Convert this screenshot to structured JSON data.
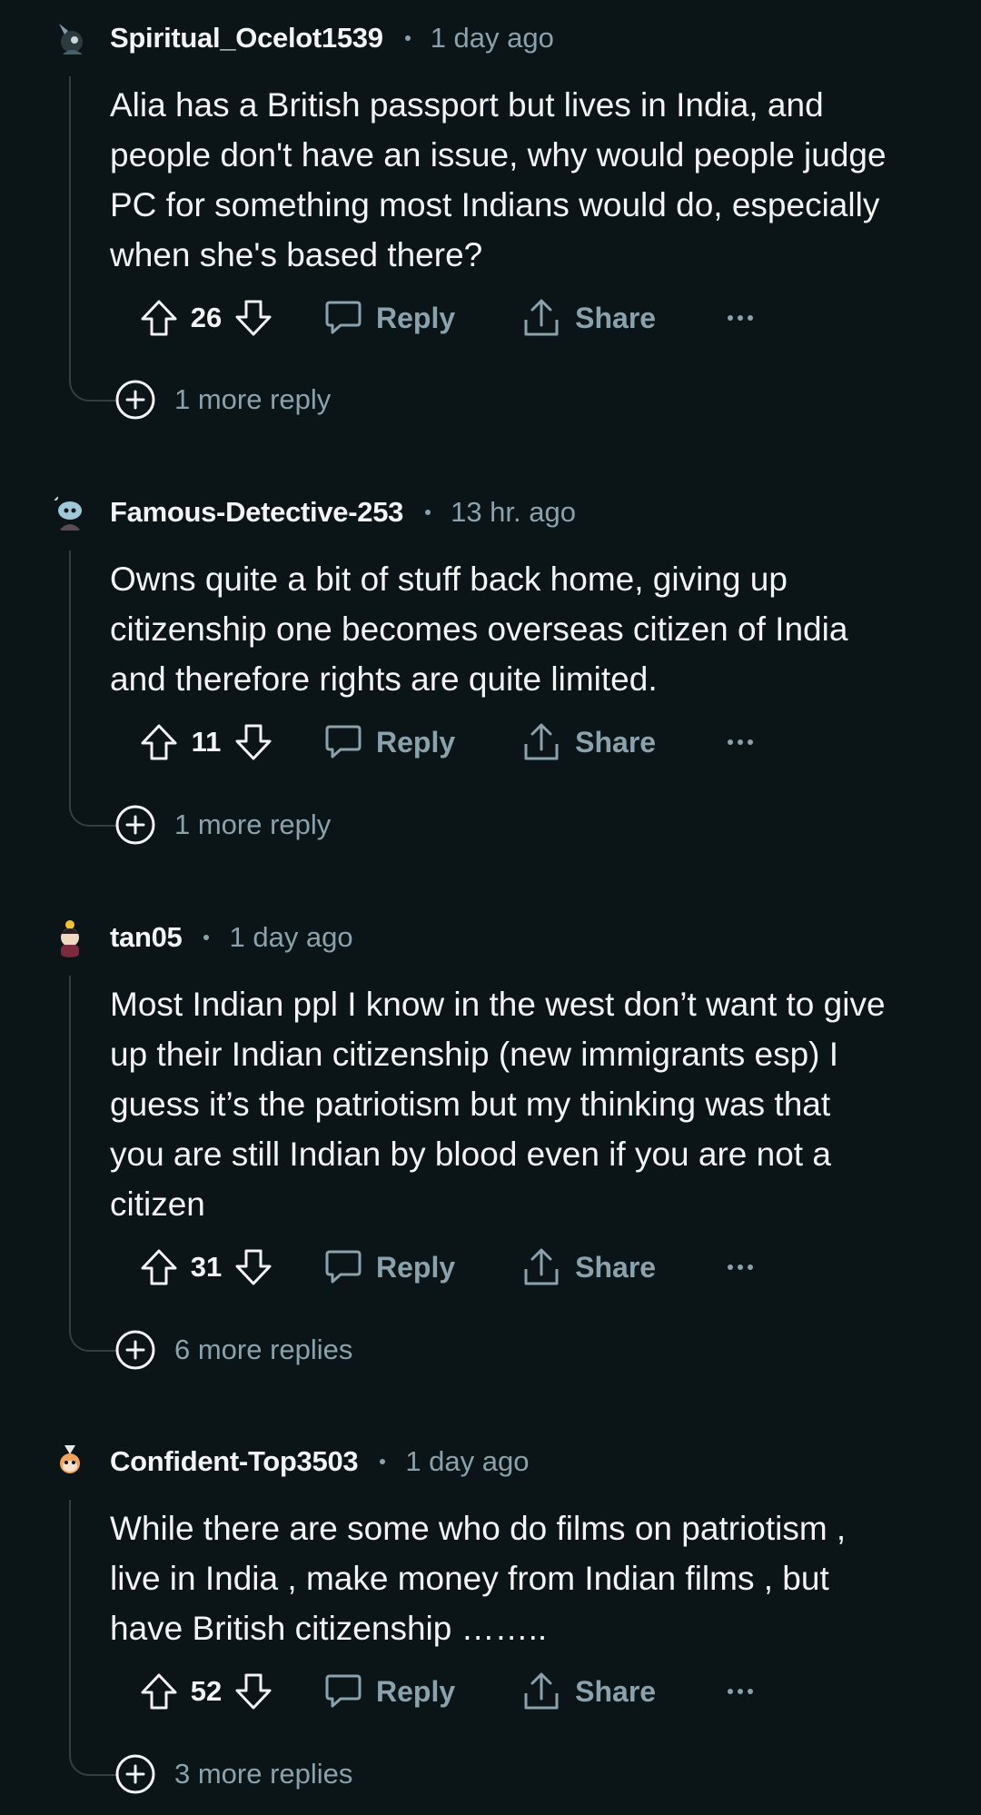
{
  "comments": [
    {
      "author": "Spiritual_Ocelot1539",
      "time": "1 day ago",
      "avatar_icon": "snoo-avatar-icon",
      "body_lines": [
        "Alia has a British passport but lives in India, and",
        "people don't have an issue, why would people judge",
        "PC for something most Indians would do, especially",
        "when she's based there?"
      ],
      "votes": "26",
      "reply_label": "Reply",
      "share_label": "Share",
      "more_replies": "1 more reply"
    },
    {
      "author": "Famous-Detective-253",
      "time": "13 hr. ago",
      "avatar_icon": "snoo-avatar-icon",
      "body_lines": [
        "Owns quite a bit of stuff back home, giving up",
        "citizenship one becomes overseas citizen of India",
        "and therefore rights are quite limited."
      ],
      "votes": "11",
      "reply_label": "Reply",
      "share_label": "Share",
      "more_replies": "1 more reply"
    },
    {
      "author": "tan05",
      "time": "1 day ago",
      "avatar_icon": "snoo-avatar-icon",
      "body_lines": [
        "Most Indian ppl I know in the west don’t want to give",
        "up their Indian citizenship (new immigrants esp) I",
        "guess it’s the patriotism but my thinking was that",
        "you are still Indian by blood even if you are not a",
        "citizen"
      ],
      "votes": "31",
      "reply_label": "Reply",
      "share_label": "Share",
      "more_replies": "6 more replies"
    },
    {
      "author": "Confident-Top3503",
      "time": "1 day ago",
      "avatar_icon": "snoo-avatar-icon",
      "body_lines": [
        "While there are some who do films on patriotism ,",
        "live in India , make money from Indian films , but",
        "have British citizenship …….."
      ],
      "votes": "52",
      "reply_label": "Reply",
      "share_label": "Share",
      "more_replies": "3 more replies"
    }
  ],
  "icons": {
    "upvote": "upvote-arrow-icon",
    "downvote": "downvote-arrow-icon",
    "reply": "speech-bubble-icon",
    "share": "share-upload-icon",
    "overflow": "more-options-icon",
    "expand": "plus-circle-icon"
  },
  "colors": {
    "background": "#0b1416",
    "text_primary": "#f2f4f5",
    "text_secondary": "#8ba2ad",
    "thread_line": "#333d42"
  }
}
